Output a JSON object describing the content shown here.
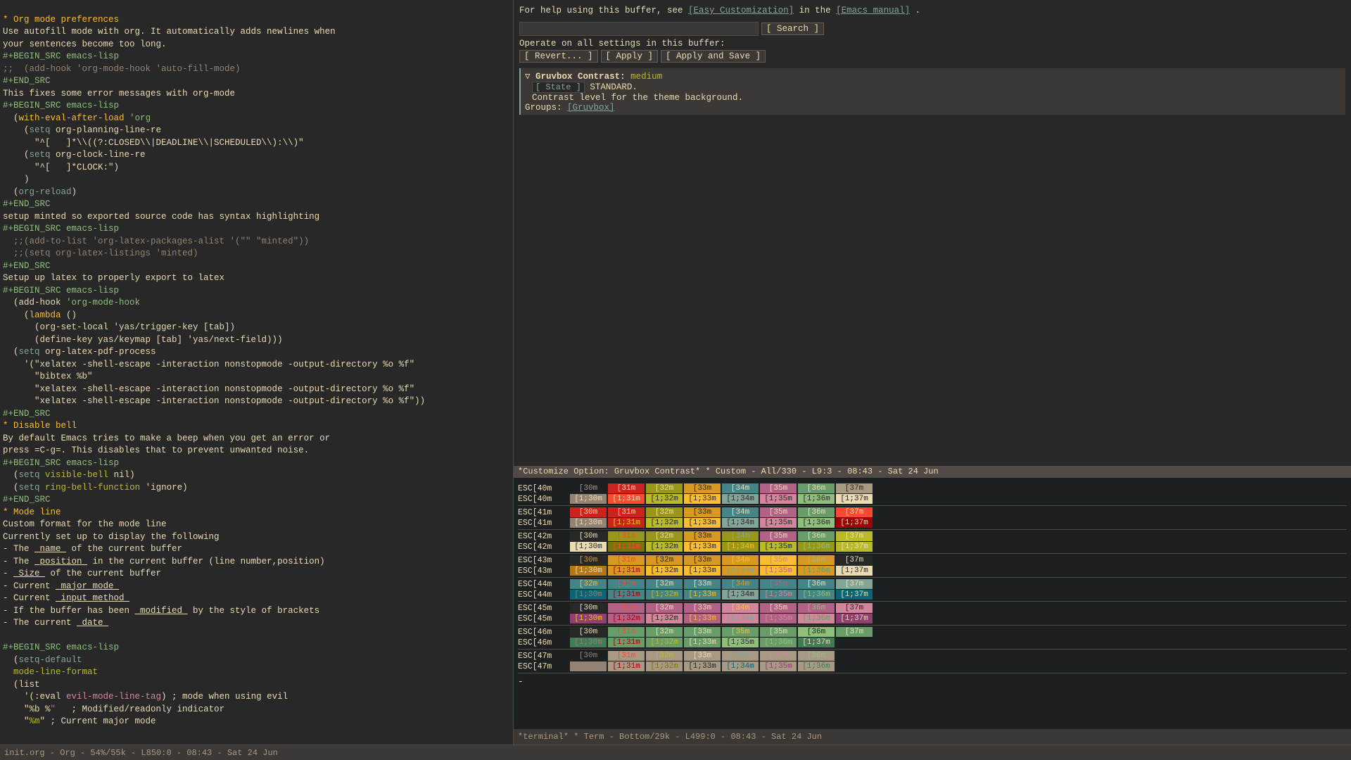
{
  "left_pane": {
    "lines": [
      {
        "type": "star-heading",
        "text": "* Org mode preferences"
      },
      {
        "type": "plain",
        "text": "Use autofill mode with org. It automatically adds newlines when"
      },
      {
        "type": "plain",
        "text": "your sentences become too long."
      },
      {
        "type": "src-begin",
        "text": "#+BEGIN_SRC emacs-lisp"
      },
      {
        "type": "comment",
        "text": ";;  (add-hook 'org-mode-hook 'auto-fill-mode)"
      },
      {
        "type": "src-end",
        "text": "#+END_SRC"
      },
      {
        "type": "plain",
        "text": "This fixes some error messages with org-mode"
      },
      {
        "type": "src-begin",
        "text": "#+BEGIN_SRC emacs-lisp"
      },
      {
        "type": "code",
        "parts": [
          {
            "text": "  (",
            "color": "fg"
          },
          {
            "text": "with-eval-after-load",
            "color": "yellow"
          },
          {
            "text": " 'org",
            "color": "aqua"
          }
        ]
      },
      {
        "type": "code2",
        "text": "    (setq org-planning-line-re"
      },
      {
        "type": "plain",
        "text": "      \"^[   ]*\\\\((?:CLOSED\\\\|DEADLINE\\\\|SCHEDULED\\\\):\\\\)\""
      },
      {
        "type": "code2",
        "text": "    (setq org-clock-line-re"
      },
      {
        "type": "plain",
        "text": "      \"^[   ]*CLOCK:\")"
      },
      {
        "type": "plain",
        "text": "    )"
      },
      {
        "type": "code-blue",
        "text": "  (org-reload)"
      },
      {
        "type": "src-end",
        "text": "#+END_SRC"
      },
      {
        "type": "plain",
        "text": "setup minted so exported source code has syntax highlighting"
      },
      {
        "type": "src-begin",
        "text": "#+BEGIN_SRC emacs-lisp"
      },
      {
        "type": "comment",
        "text": "  ;;(add-to-list 'org-latex-packages-alist '(\"\" \"minted\"))"
      },
      {
        "type": "comment",
        "text": "  ;;(setq org-latex-listings 'minted)"
      },
      {
        "type": "src-end",
        "text": "#+END_SRC"
      },
      {
        "type": "plain",
        "text": "Setup up latex to properly export to latex"
      },
      {
        "type": "src-begin",
        "text": "#+BEGIN_SRC emacs-lisp"
      },
      {
        "type": "code-add-hook",
        "text": "  (add-hook 'org-mode-hook"
      },
      {
        "type": "code-lambda",
        "text": "    (lambda ()"
      },
      {
        "type": "plain",
        "text": "      (org-set-local 'yas/trigger-key [tab])"
      },
      {
        "type": "plain",
        "text": "      (define-key yas/keymap [tab] 'yas/next-field)))"
      },
      {
        "type": "code2",
        "text": "  (setq org-latex-pdf-process"
      },
      {
        "type": "plain",
        "text": "    '(\"xelatex -shell-escape -interaction nonstopmode -output-directory %o %f\""
      },
      {
        "type": "plain",
        "text": "      \"bibtex %b\""
      },
      {
        "type": "plain",
        "text": "      \"xelatex -shell-escape -interaction nonstopmode -output-directory %o %f\""
      },
      {
        "type": "plain",
        "text": "      \"xelatex -shell-escape -interaction nonstopmode -output-directory %o %f\"))"
      },
      {
        "type": "src-end",
        "text": "#+END_SRC"
      },
      {
        "type": "star-heading",
        "text": "* Disable bell"
      },
      {
        "type": "plain",
        "text": "By default Emacs tries to make a beep when you get an error or"
      },
      {
        "type": "plain2",
        "text": "press =C-g=. This disables that to prevent unwanted noise."
      },
      {
        "type": "src-begin",
        "text": "#+BEGIN_SRC emacs-lisp"
      },
      {
        "type": "code-visible",
        "text": "  (setq visible-bell nil)"
      },
      {
        "type": "code-ring",
        "text": "  (setq ring-bell-function 'ignore)"
      },
      {
        "type": "src-end",
        "text": "#+END_SRC"
      },
      {
        "type": "star-heading",
        "text": "* Mode line"
      },
      {
        "type": "plain",
        "text": "Custom format for the mode line"
      },
      {
        "type": "plain",
        "text": "Currently set up to display the following"
      },
      {
        "type": "plain-ul",
        "text": "- The _name_ of the current buffer"
      },
      {
        "type": "plain-ul",
        "text": "- The _position_ in the current buffer (line number,position)"
      },
      {
        "type": "plain-ul",
        "text": "- _Size_ of the current buffer"
      },
      {
        "type": "plain-ul",
        "text": "- Current _major mode_"
      },
      {
        "type": "plain-ul",
        "text": "- Current _input method_"
      },
      {
        "type": "plain-ul2",
        "text": "- If the buffer has been _modified_ by the style of brackets"
      },
      {
        "type": "plain-ul",
        "text": "- The current _date_"
      },
      {
        "type": "plain",
        "text": ""
      },
      {
        "type": "src-begin",
        "text": "#+BEGIN_SRC emacs-lisp"
      },
      {
        "type": "code-setq-default",
        "text": "  (setq-default"
      },
      {
        "type": "code-mode-line-format",
        "text": "  mode-line-format"
      },
      {
        "type": "code-list",
        "text": "  (list"
      },
      {
        "type": "plain",
        "text": "    '(:eval evil-mode-line-tag) ; mode when using evil"
      },
      {
        "type": "plain",
        "text": "    \"%b %\" \" ; Modified/readonly indicator"
      },
      {
        "type": "plain",
        "text": "    \"%m\" ; Current major mode"
      }
    ],
    "status": "init.org - Org - 54%/55k - L850:0 - 08:43 - Sat 24 Jun"
  },
  "right_pane": {
    "header_text": "For help using this buffer, see",
    "easy_customization_link": "[Easy Customization]",
    "in_text": "in the",
    "emacs_manual_link": "[Emacs manual]",
    "period": ".",
    "search_placeholder": "",
    "search_btn": "[ Search ]",
    "operate_text": "Operate on all settings in this buffer:",
    "revert_btn": "[ Revert... ]",
    "apply_btn": "[ Apply ]",
    "apply_save_btn": "[ Apply and Save ]",
    "gruvbox": {
      "triangle": "▽",
      "label": "Gruvbox Contrast:",
      "value": "medium",
      "state_btn": "[ State ]",
      "state_value": "STANDARD.",
      "desc": "Contrast level for the theme background.",
      "groups_label": "Groups:",
      "groups_link": "[Gruvbox]"
    },
    "mode_line": "*Customize Option: Gruvbox Contrast* * Custom - All/330 - L9:3 - 08:43 - Sat 24 Jun",
    "title": "Custom",
    "color_grid": {
      "rows": [
        {
          "label1": "ESC[40m",
          "label2": "ESC[40m",
          "cells1": [
            {
              "text": "[30m",
              "bg": "bg-dark"
            },
            {
              "text": "[31m",
              "bg": "bg-31r"
            },
            {
              "text": "[32m",
              "bg": "bg-32g"
            },
            {
              "text": "[33m",
              "bg": "bg-33y"
            },
            {
              "text": "[34m",
              "bg": "bg-34b"
            },
            {
              "text": "[35m",
              "bg": "bg-35p"
            },
            {
              "text": "[36m",
              "bg": "bg-36a"
            },
            {
              "text": "[37m",
              "bg": "bg-37w"
            }
          ],
          "cells2": [
            {
              "text": "[1;30m",
              "bg": "bg-br30"
            },
            {
              "text": "[1;31m",
              "bg": "bg-br31"
            },
            {
              "text": "[1;32m",
              "bg": "bg-br32"
            },
            {
              "text": "[1;33m",
              "bg": "bg-br33"
            },
            {
              "text": "[1;34m",
              "bg": "bg-br34"
            },
            {
              "text": "[1;35m",
              "bg": "bg-br35"
            },
            {
              "text": "[1;36m",
              "bg": "bg-br36"
            },
            {
              "text": "[1;37m",
              "bg": "bg-br37"
            }
          ]
        }
      ]
    }
  },
  "terminal": {
    "status": "*terminal* * Term - Bottom/29k - L499:0 - 08:43 - Sat 24 Jun",
    "cursor": "-"
  }
}
